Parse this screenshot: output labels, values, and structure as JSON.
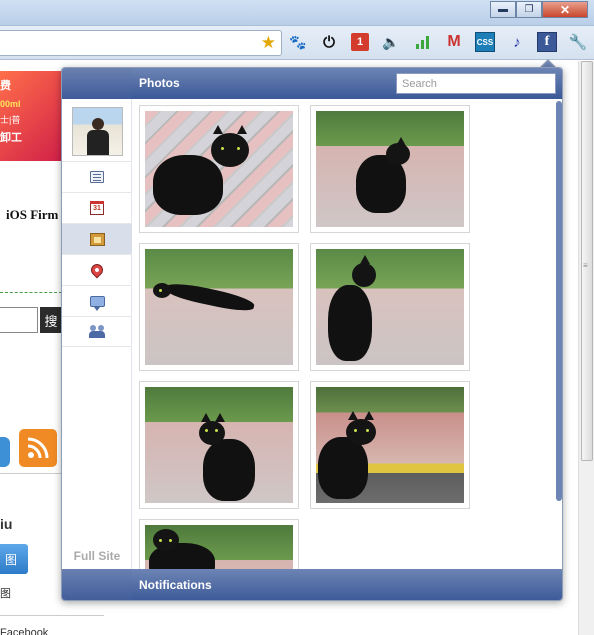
{
  "browser": {
    "window_buttons": {
      "minimize": "▬",
      "maximize": "❐",
      "close": "✕"
    },
    "extensions": {
      "star": "★",
      "paw": "🐾",
      "power": "⏻",
      "badge_number": "1",
      "speaker": "🔈",
      "mail": "M",
      "css": "CSS",
      "music": "♪",
      "facebook": "f",
      "wrench": "🔧"
    }
  },
  "background_page": {
    "banner": {
      "line1": "费",
      "line2": "00ml",
      "line3": "士|普",
      "line4": "卸工"
    },
    "ios_text": "iOS Firm",
    "search_button_label": "搜",
    "iu_text": "iu",
    "blue_button_label": "图",
    "small_text": "图",
    "bottom_text": "Facebook"
  },
  "popup": {
    "header_title": "Photos",
    "search_placeholder": "Search",
    "full_site_label": "Full Site",
    "footer_title": "Notifications",
    "sidebar_items": [
      {
        "name": "news-feed"
      },
      {
        "name": "events",
        "cal_text": "31"
      },
      {
        "name": "photos",
        "active": true
      },
      {
        "name": "places"
      },
      {
        "name": "messages"
      },
      {
        "name": "friends"
      }
    ],
    "photos": [
      {
        "subject": "black cat on brick pavement"
      },
      {
        "subject": "black cat sitting facing plants"
      },
      {
        "subject": "black cat lying on pavement"
      },
      {
        "subject": "black cat sitting, back view"
      },
      {
        "subject": "black cat sitting among plants"
      },
      {
        "subject": "black cat sitting on road"
      },
      {
        "subject": "black cat partially visible"
      }
    ]
  },
  "colors": {
    "facebook_blue": "#3b5998",
    "header_gradient_top": "#6d84b4",
    "active_nav": "#d8dfea"
  }
}
